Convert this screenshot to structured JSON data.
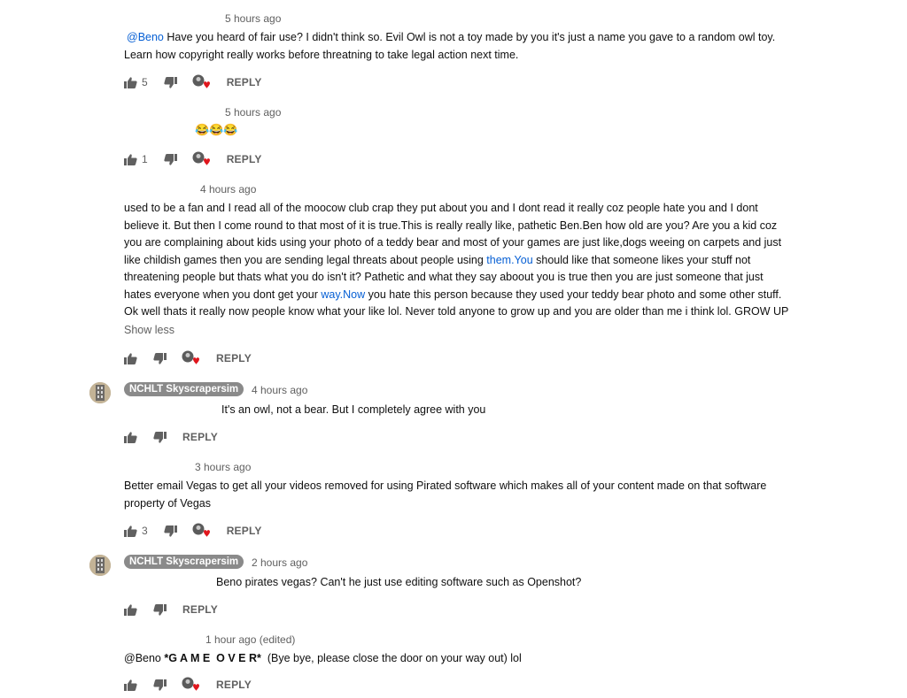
{
  "comments": [
    {
      "timestamp": "5 hours ago",
      "mention": "@Beno",
      "text_line1": " Have you heard of fair use? I didn't think so. Evil Owl is not a toy made by you it's just a name you gave to a random owl toy.",
      "text_line2": "Learn how copyright really works before threatning to take legal action next time.",
      "likes": "5",
      "reply_label": "REPLY"
    },
    {
      "timestamp": "5 hours ago",
      "emoji": "😂😂😂",
      "likes": "1",
      "reply_label": "REPLY"
    },
    {
      "timestamp": "4 hours ago",
      "lines": [
        "used to be a fan and I read all of the moocow club crap they put about you and I dont read it really coz people hate you and I dont",
        "believe it. But then I come round to that most of it is true.This is really really like, pathetic Ben.Ben how old are you? Are you a kid coz",
        "you are complaining about kids using your photo of a teddy bear and most of your games are just like,dogs weeing on carpets and just",
        "like childish games then you are sending legal threats about people using ",
        "threatening people but thats what you do isn't it? Pathetic and what they say aboout you is true then you are just someone that just",
        "hates everyone when you dont get your ",
        "Ok well thats it really now people know what your like lol. Never told anyone to grow up and you are older than me i think lol. GROW UP"
      ],
      "link1": "them.You",
      "line4_tail": " should like that someone likes your stuff not",
      "link2": "way.Now",
      "line6_tail": " you hate this person because they used your teddy bear photo and some other stuff.",
      "show_less": "Show less",
      "reply_label": "REPLY"
    },
    {
      "author": "NCHLT Skyscrapersim",
      "timestamp": "4 hours ago",
      "text": "It's an owl, not a bear. But I completely agree with you",
      "reply_label": "REPLY"
    },
    {
      "timestamp": "3 hours ago",
      "text_line1": "Better email Vegas to get all your videos removed for using Pirated software which makes all of your content made on that software",
      "text_line2": "property of Vegas",
      "likes": "3",
      "reply_label": "REPLY"
    },
    {
      "author": "NCHLT Skyscrapersim",
      "timestamp": "2 hours ago",
      "text": "Beno pirates vegas? Can't he just use editing software such as Openshot?",
      "reply_label": "REPLY"
    },
    {
      "timestamp": "1 hour ago (edited)",
      "mention": "@Beno ",
      "bold_text": "*G A M E  O V E R*",
      "text_tail": "  (Bye bye, please close the door on your way out) lol",
      "reply_label": "REPLY"
    }
  ],
  "colors": {
    "link": "#065fd4",
    "meta": "#606060",
    "chip": "#8a8a8a",
    "heart": "#e0161d"
  }
}
